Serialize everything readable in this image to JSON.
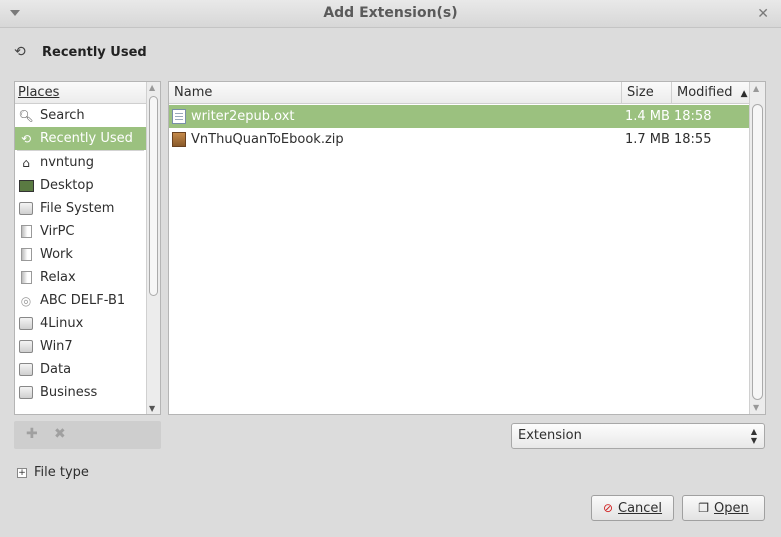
{
  "window": {
    "title": "Add Extension(s)"
  },
  "location": {
    "label": "Recently Used",
    "icon": "history-icon"
  },
  "places": {
    "header": "Places",
    "items": [
      {
        "label": "Search",
        "icon": "search-icon"
      },
      {
        "label": "Recently Used",
        "icon": "history-icon",
        "selected": true
      },
      {
        "label": "nvntung",
        "icon": "home-icon"
      },
      {
        "label": "Desktop",
        "icon": "desktop-icon"
      },
      {
        "label": "File System",
        "icon": "drive-icon"
      },
      {
        "label": "VirPC",
        "icon": "folder-icon"
      },
      {
        "label": "Work",
        "icon": "folder-icon"
      },
      {
        "label": "Relax",
        "icon": "folder-icon"
      },
      {
        "label": "ABC DELF-B1",
        "icon": "cdrom-icon"
      },
      {
        "label": "4Linux",
        "icon": "drive-icon"
      },
      {
        "label": "Win7",
        "icon": "drive-icon"
      },
      {
        "label": "Data",
        "icon": "drive-icon"
      },
      {
        "label": "Business",
        "icon": "drive-icon"
      }
    ]
  },
  "files": {
    "columns": {
      "name": "Name",
      "size": "Size",
      "modified": "Modified"
    },
    "rows": [
      {
        "name": "writer2epub.oxt",
        "size": "1.4 MB",
        "modified": "18:58",
        "icon": "document-icon",
        "selected": true
      },
      {
        "name": "VnThuQuanToEbook.zip",
        "size": "1.7 MB",
        "modified": "18:55",
        "icon": "archive-icon"
      }
    ]
  },
  "filter": {
    "value": "Extension"
  },
  "file_type": {
    "label": "File type"
  },
  "buttons": {
    "cancel": "Cancel",
    "open": "Open"
  },
  "colors": {
    "selection": "#9bc17f"
  }
}
